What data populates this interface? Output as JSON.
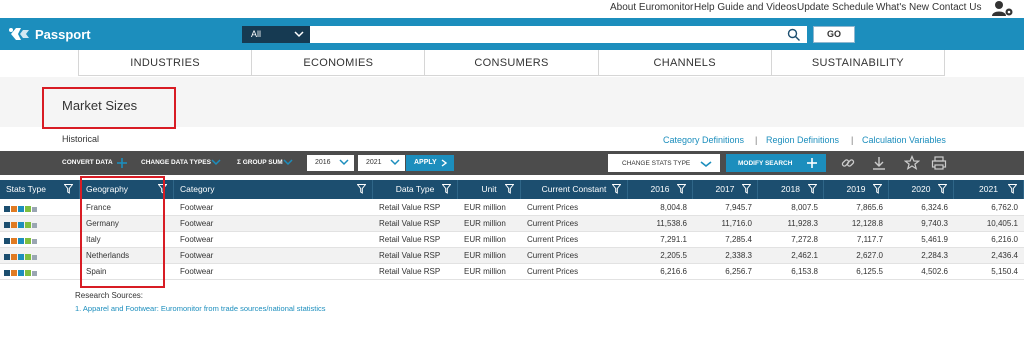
{
  "top_links": [
    "About Euromonitor",
    "Help Guide and Videos",
    "Update Schedule",
    "What's New",
    "Contact Us"
  ],
  "header": {
    "app_name": "Passport",
    "scope_value": "All",
    "search_value": "",
    "go_label": "GO"
  },
  "nav": [
    "INDUSTRIES",
    "ECONOMIES",
    "CONSUMERS",
    "CHANNELS",
    "SUSTAINABILITY"
  ],
  "page": {
    "title": "Market Sizes",
    "subtitle": "Historical",
    "definition_links": [
      "Category Definitions",
      "Region Definitions",
      "Calculation Variables"
    ],
    "separator": "|"
  },
  "toolbar": {
    "convert_data": "CONVERT DATA",
    "change_data_types": "CHANGE DATA TYPES",
    "group_sum": "Σ GROUP SUM",
    "year_from": "2016",
    "year_to": "2021",
    "apply": "APPLY",
    "change_stats_type": "CHANGE STATS TYPE",
    "modify_search": "MODIFY SEARCH"
  },
  "table": {
    "columns": [
      "Stats Type",
      "Geography",
      "Category",
      "Data Type",
      "Unit",
      "Current Constant",
      "2016",
      "2017",
      "2018",
      "2019",
      "2020",
      "2021"
    ],
    "rows": [
      {
        "geography": "France",
        "category": "Footwear",
        "data_type": "Retail Value RSP",
        "unit": "EUR million",
        "current_constant": "Current Prices",
        "values": [
          "8,004.8",
          "7,945.7",
          "8,007.5",
          "7,865.6",
          "6,324.6",
          "6,762.0"
        ]
      },
      {
        "geography": "Germany",
        "category": "Footwear",
        "data_type": "Retail Value RSP",
        "unit": "EUR million",
        "current_constant": "Current Prices",
        "values": [
          "11,538.6",
          "11,716.0",
          "11,928.3",
          "12,128.8",
          "9,740.3",
          "10,405.1"
        ]
      },
      {
        "geography": "Italy",
        "category": "Footwear",
        "data_type": "Retail Value RSP",
        "unit": "EUR million",
        "current_constant": "Current Prices",
        "values": [
          "7,291.1",
          "7,285.4",
          "7,272.8",
          "7,117.7",
          "5,461.9",
          "6,216.0"
        ]
      },
      {
        "geography": "Netherlands",
        "category": "Footwear",
        "data_type": "Retail Value RSP",
        "unit": "EUR million",
        "current_constant": "Current Prices",
        "values": [
          "2,205.5",
          "2,338.3",
          "2,462.1",
          "2,627.0",
          "2,284.3",
          "2,436.4"
        ]
      },
      {
        "geography": "Spain",
        "category": "Footwear",
        "data_type": "Retail Value RSP",
        "unit": "EUR million",
        "current_constant": "Current Prices",
        "values": [
          "6,216.6",
          "6,256.7",
          "6,153.8",
          "6,125.5",
          "4,502.6",
          "5,150.4"
        ]
      }
    ]
  },
  "sources": {
    "label": "Research Sources:",
    "items": [
      "1. Apparel and Footwear: Euromonitor from trade sources/national statistics"
    ]
  },
  "icons": {
    "stats_type": [
      "bar-chart-icon",
      "line-chart-icon",
      "pie-chart-icon",
      "table-icon",
      "column-chart-icon"
    ],
    "toolbar": [
      "link-icon",
      "download-icon",
      "star-icon",
      "print-icon"
    ]
  },
  "colors": {
    "brand_blue": "#1c8ebd",
    "header_dark": "#1c4e6f",
    "toolbar_dark": "#4c4c4c",
    "highlight_red": "#d81c24",
    "stats_icon_colors": [
      "#1c4e6f",
      "#e07b22",
      "#1c8ebd",
      "#7fbf3f",
      "#9aa6b2"
    ]
  }
}
